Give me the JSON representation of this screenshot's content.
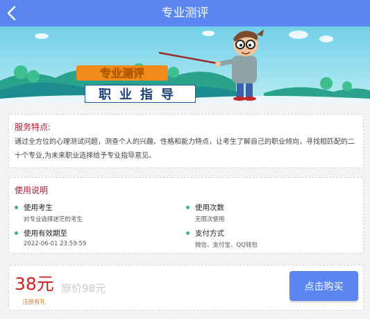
{
  "header": {
    "title": "专业测评",
    "back_icon": "back-arrow-icon"
  },
  "banner": {
    "line1": "专业测评",
    "line2": "职业指导"
  },
  "features": {
    "title": "服务特点:",
    "description": "通过全方位的心理测试问题，测查个人的兴趣、性格和能力特点，让考生了解自己的职业倾向，寻找相匹配的二十个专业,为未来职业选择给予专业指导意见。"
  },
  "usage": {
    "title": "使用说明",
    "items": [
      {
        "label": "使用考生",
        "value": "对专业选择迷茫的考生"
      },
      {
        "label": "使用次数",
        "value": "无限次使用"
      },
      {
        "label": "使用有效期至",
        "value": "2022-06-01 23:59:59"
      },
      {
        "label": "支付方式",
        "value": "微信、支付宝、QQ钱包"
      }
    ]
  },
  "purchase": {
    "price": "38元",
    "original_price": "原价98元",
    "note": "注册有礼",
    "buy_label": "点击购买"
  },
  "colors": {
    "header": "#5b86f2",
    "accent_red": "#c8102e",
    "price_red": "#d2201d",
    "note_orange": "#f07d1a",
    "bullet_green": "#3cb371"
  }
}
